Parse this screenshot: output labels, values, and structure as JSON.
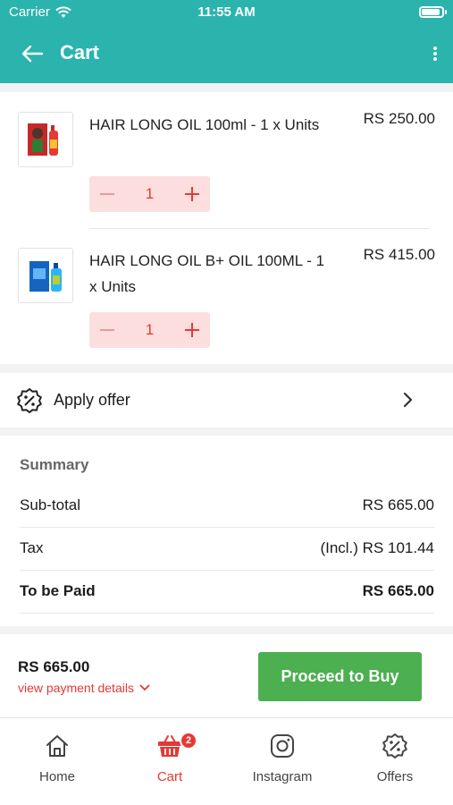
{
  "status_bar": {
    "carrier": "Carrier",
    "time": "11:55 AM"
  },
  "header": {
    "title": "Cart",
    "accent_color": "#2bb3ad"
  },
  "cart": {
    "items": [
      {
        "name": "HAIR LONG OIL 100ml  - 1 x Units",
        "price": "RS 250.00",
        "quantity": "1"
      },
      {
        "name": "HAIR LONG OIL B+ OIL 100ML - 1 x Units",
        "price": "RS 415.00",
        "quantity": "1"
      }
    ]
  },
  "offer": {
    "label": "Apply offer",
    "icon": "discount-badge-icon"
  },
  "summary": {
    "heading": "Summary",
    "rows": [
      {
        "label": "Sub-total",
        "value": "RS 665.00"
      },
      {
        "label": "Tax",
        "value": "(Incl.) RS 101.44"
      },
      {
        "label": "To be Paid",
        "value": "RS 665.00"
      }
    ]
  },
  "checkout": {
    "total": "RS 665.00",
    "details_link": "view payment details",
    "buy_label": "Proceed to Buy",
    "buy_color": "#4caf50"
  },
  "tabs": [
    {
      "label": "Home",
      "icon": "home-icon"
    },
    {
      "label": "Cart",
      "icon": "cart-icon",
      "badge": "2",
      "active": true
    },
    {
      "label": "Instagram",
      "icon": "instagram-icon"
    },
    {
      "label": "Offers",
      "icon": "discount-badge-icon"
    }
  ]
}
